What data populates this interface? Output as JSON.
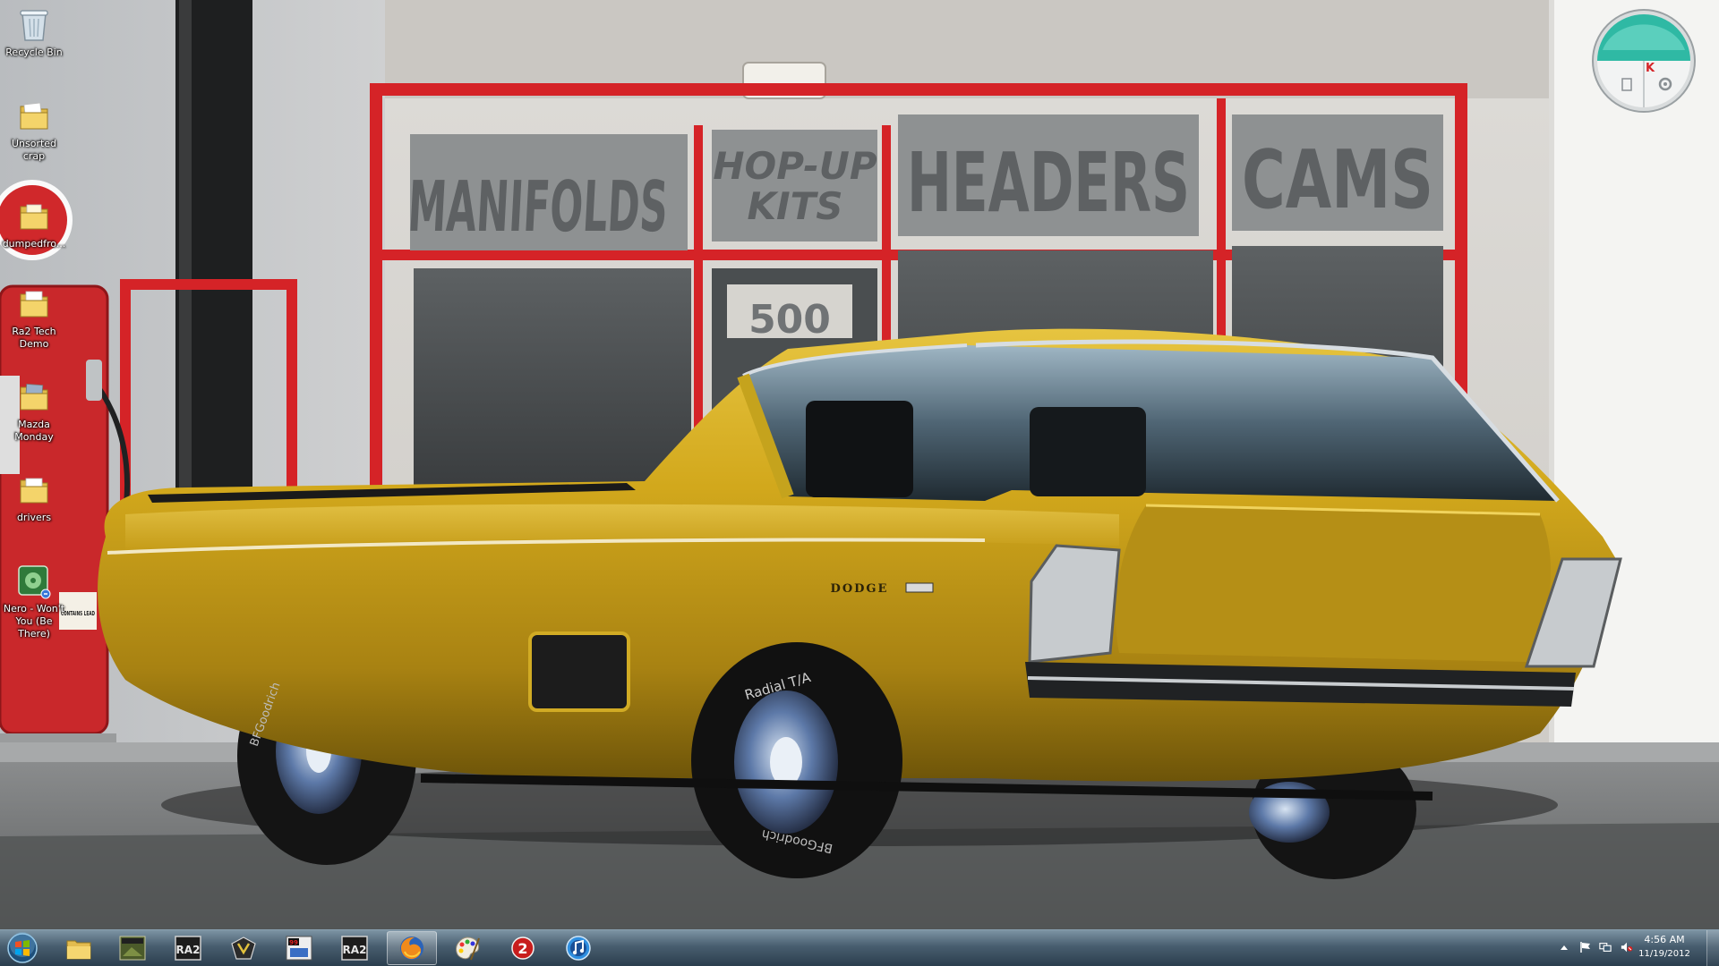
{
  "desktop": {
    "icons": [
      {
        "name": "recycle-bin",
        "label": "Recycle Bin",
        "icon": "recycle-bin-icon"
      },
      {
        "name": "unsorted-crap",
        "label": "Unsorted crap",
        "icon": "folder-icon"
      },
      {
        "name": "dumpedfro",
        "label": "dumpedfro...",
        "icon": "folder-icon"
      },
      {
        "name": "ra2-tech-demo",
        "label": "Ra2 Tech Demo",
        "icon": "folder-icon"
      },
      {
        "name": "mazda-monday",
        "label": "Mazda Monday",
        "icon": "folder-icon"
      },
      {
        "name": "drivers",
        "label": "drivers",
        "icon": "folder-icon"
      },
      {
        "name": "nero-wont-you",
        "label": "Nero - Won't You (Be There)",
        "icon": "media-file-icon"
      }
    ]
  },
  "wallpaper": {
    "signs": [
      "MANIFOLDS",
      "HOP-UP",
      "KITS",
      "HEADERS",
      "CAMS"
    ],
    "door_number": "500",
    "pump_sign": "CONTAINS LEAD",
    "car_badge": "DODGE",
    "tire_text": "BFGoodrich",
    "tire_text_2": "Radial T/A",
    "colors": {
      "car_gold": "#c9a21a",
      "shop_red": "#d82024",
      "wall": "#e9e7e3"
    }
  },
  "gadget": {
    "name": "kaspersky-gadget",
    "accent": "#2fb9a4"
  },
  "taskbar": {
    "start_icon": "windows-start-orb-icon",
    "pinned": [
      {
        "name": "explorer",
        "icon": "folder-explorer-icon",
        "active": false
      },
      {
        "name": "battlefield",
        "icon": "battlefield-game-icon",
        "active": false
      },
      {
        "name": "ra2-a",
        "icon": "ra2-game-icon",
        "active": false
      },
      {
        "name": "yuri",
        "icon": "yuri-emblem-icon",
        "active": false
      },
      {
        "name": "tiberian",
        "icon": "tiberian-game-icon",
        "active": false
      },
      {
        "name": "ra2-b",
        "icon": "ra2-game-icon",
        "active": false
      },
      {
        "name": "firefox",
        "icon": "firefox-icon",
        "active": true
      },
      {
        "name": "paint",
        "icon": "paint-palette-icon",
        "active": false
      },
      {
        "name": "ra2-uprising",
        "icon": "red-alert-2-icon",
        "active": false
      },
      {
        "name": "itunes",
        "icon": "itunes-icon",
        "active": false
      }
    ],
    "ra2_label": "RA2",
    "tray": {
      "icons": [
        "chevron-up-icon",
        "flag-icon",
        "network-icon",
        "volume-muted-icon"
      ]
    },
    "clock": {
      "time": "4:56 AM",
      "date": "11/19/2012"
    }
  }
}
